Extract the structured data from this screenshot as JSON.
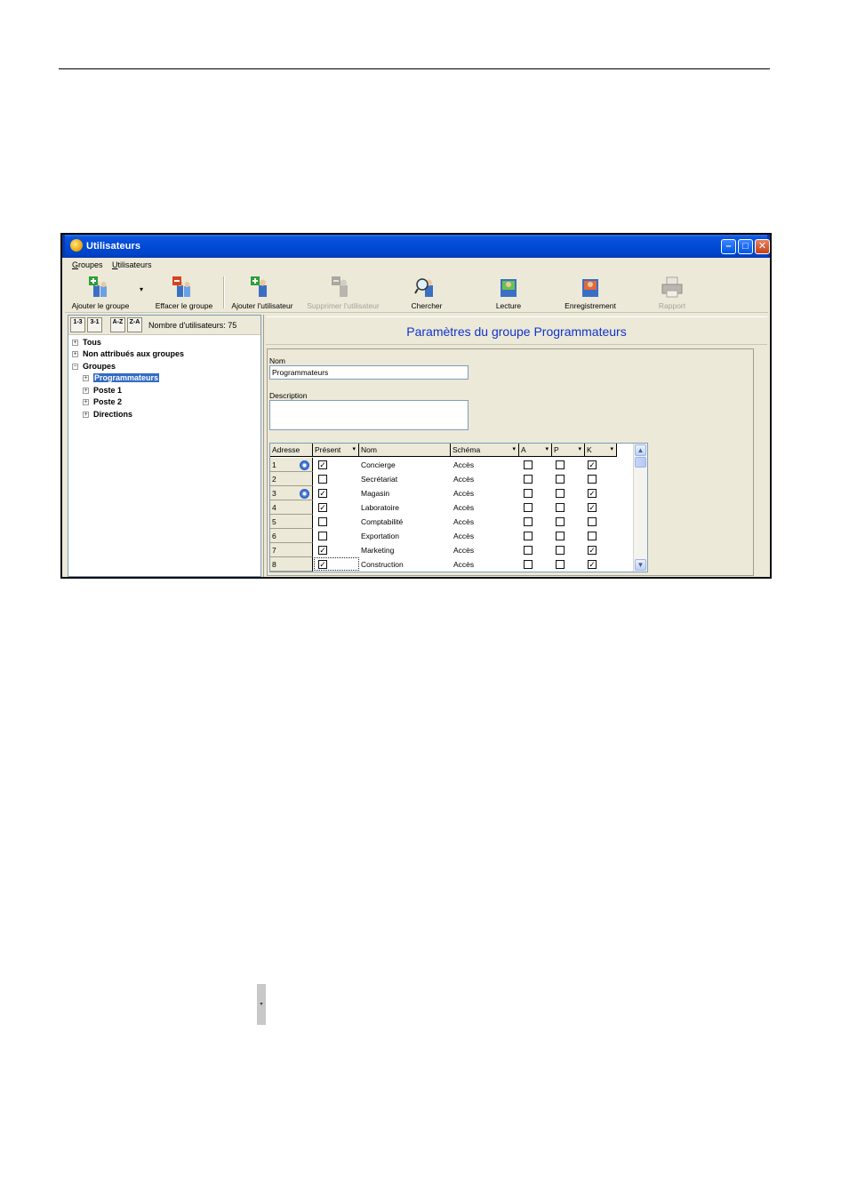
{
  "window": {
    "title": "Utilisateurs",
    "controls": {
      "minimize": "–",
      "maximize": "□",
      "close": "✕"
    }
  },
  "menu": [
    {
      "first": "G",
      "rest": "roupes"
    },
    {
      "first": "U",
      "rest": "tilisateurs"
    }
  ],
  "toolbar": {
    "add_group": "Ajouter le groupe",
    "dropdown": "▾",
    "delete_group": "Effacer le groupe",
    "add_user": "Ajouter l'utilisateur",
    "remove_user": "Supprimer l'utilisateur",
    "search": "Chercher",
    "read": "Lecture",
    "save": "Enregistrement",
    "report": "Rapport"
  },
  "sortbar": {
    "btn1": "1-3",
    "btn2": "3-1",
    "btn3": "A-Z",
    "btn4": "Z-A",
    "user_count": "Nombre d'utilisateurs: 75"
  },
  "tree": [
    {
      "label": "Tous",
      "exp": "+",
      "level": 0,
      "selected": false
    },
    {
      "label": "Non attribués aux groupes",
      "exp": "+",
      "level": 0,
      "selected": false
    },
    {
      "label": "Groupes",
      "exp": "−",
      "level": 0,
      "selected": false
    },
    {
      "label": "Programmateurs",
      "exp": "+",
      "level": 1,
      "selected": true
    },
    {
      "label": "Poste 1",
      "exp": "+",
      "level": 1,
      "selected": false
    },
    {
      "label": "Poste 2",
      "exp": "+",
      "level": 1,
      "selected": false
    },
    {
      "label": "Directions",
      "exp": "+",
      "level": 1,
      "selected": false
    }
  ],
  "group": {
    "title": "Paramètres du groupe Programmateurs",
    "name_label": "Nom",
    "name_value": "Programmateurs",
    "description_label": "Description",
    "description_value": ""
  },
  "grid": {
    "headers": {
      "address": "Adresse",
      "present": "Présent",
      "name": "Nom",
      "schema": "Schéma",
      "a": "A",
      "p": "P",
      "k": "K"
    },
    "dropdown_glyph": "▾",
    "rows": [
      {
        "address": "1",
        "badge": true,
        "present": true,
        "name": "Concierge",
        "schema": "Accès",
        "a": false,
        "p": false,
        "k": true
      },
      {
        "address": "2",
        "badge": false,
        "present": false,
        "name": "Secrétariat",
        "schema": "Accès",
        "a": false,
        "p": false,
        "k": false
      },
      {
        "address": "3",
        "badge": true,
        "present": true,
        "name": "Magasin",
        "schema": "Accès",
        "a": false,
        "p": false,
        "k": true
      },
      {
        "address": "4",
        "badge": false,
        "present": true,
        "name": "Laboratoire",
        "schema": "Accès",
        "a": false,
        "p": false,
        "k": true
      },
      {
        "address": "5",
        "badge": false,
        "present": false,
        "name": "Comptabilité",
        "schema": "Accès",
        "a": false,
        "p": false,
        "k": false
      },
      {
        "address": "6",
        "badge": false,
        "present": false,
        "name": "Exportation",
        "schema": "Accès",
        "a": false,
        "p": false,
        "k": false
      },
      {
        "address": "7",
        "badge": false,
        "present": true,
        "name": "Marketing",
        "schema": "Accès",
        "a": false,
        "p": false,
        "k": true
      },
      {
        "address": "8",
        "badge": false,
        "present": true,
        "name": "Construction",
        "schema": "Accès",
        "a": false,
        "p": false,
        "k": true
      }
    ],
    "check_glyph": "✓",
    "scroll_up": "▲",
    "scroll_down": "▼"
  },
  "stray_glyph": "▾",
  "colors": {
    "titlebar": "#0049d6",
    "selection": "#316ac5",
    "group_title": "#1133cc",
    "window_bg": "#ece9d8"
  }
}
